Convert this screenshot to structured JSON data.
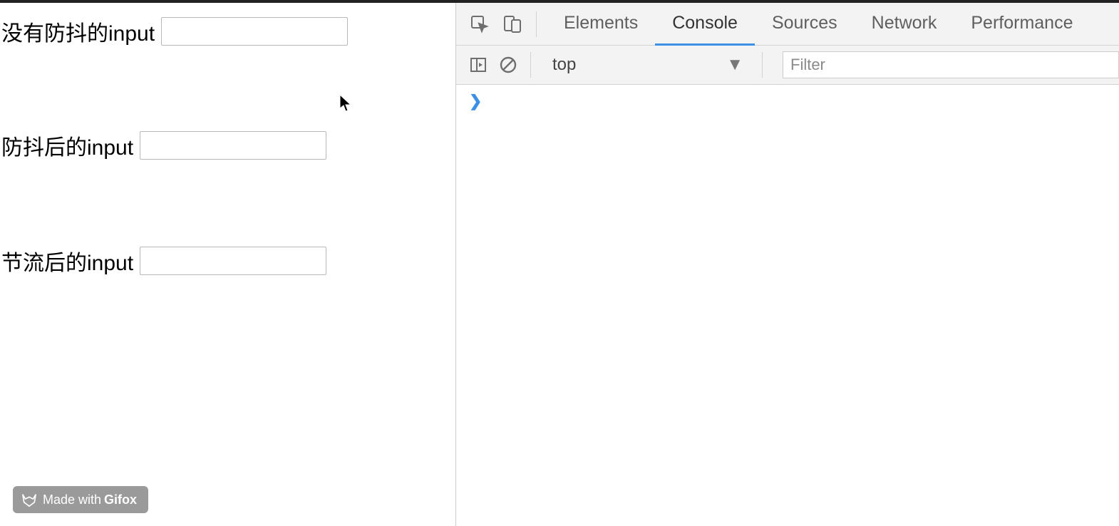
{
  "page": {
    "fields": [
      {
        "label": "没有防抖的input",
        "value": ""
      },
      {
        "label": "防抖后的input",
        "value": ""
      },
      {
        "label": "节流后的input",
        "value": ""
      }
    ],
    "badge": {
      "prefix": "Made with ",
      "brand": "Gifox"
    }
  },
  "devtools": {
    "tabs": [
      "Elements",
      "Console",
      "Sources",
      "Network",
      "Performance"
    ],
    "active_tab": "Console",
    "context_selector": "top",
    "filter_placeholder": "Filter",
    "prompt_symbol": "❯"
  }
}
